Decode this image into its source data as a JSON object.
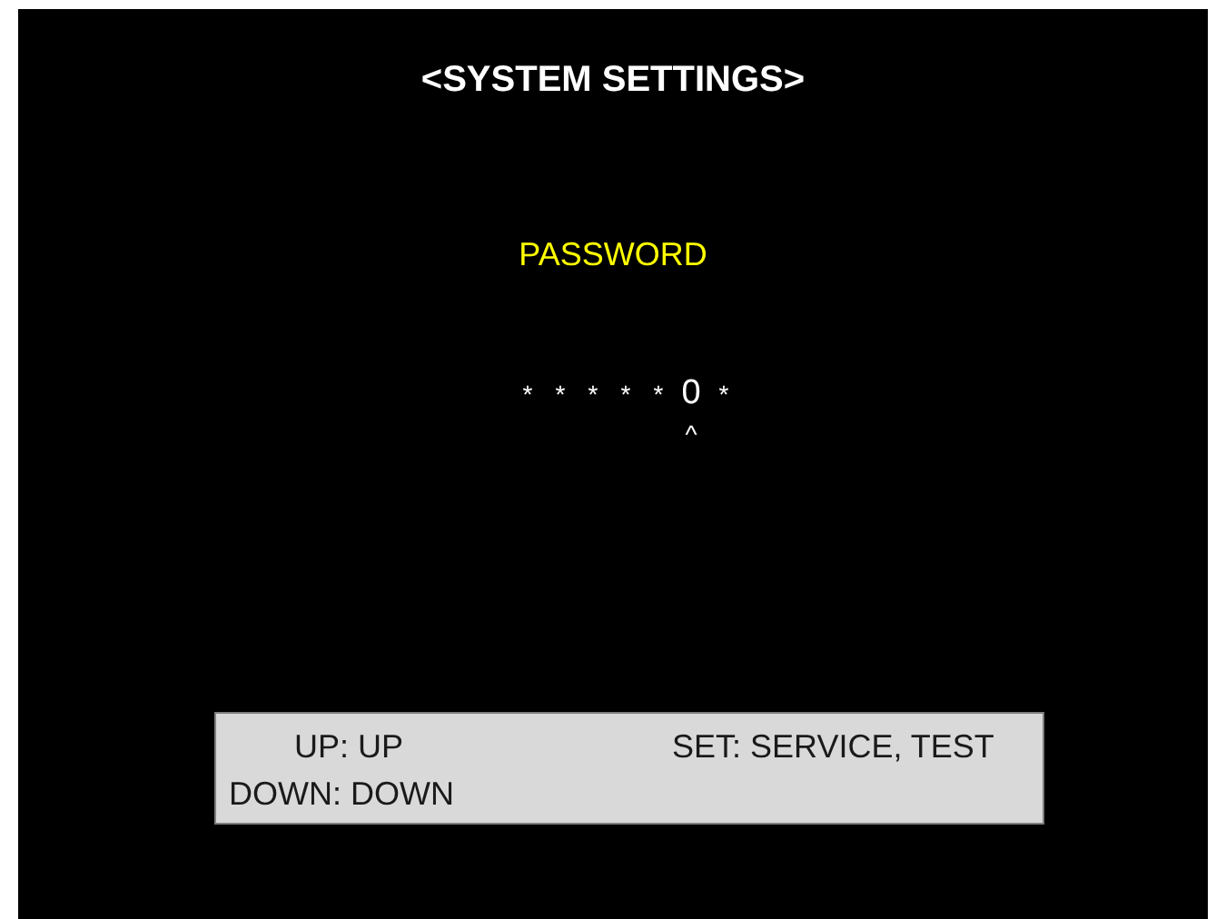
{
  "title": "<SYSTEM SETTINGS>",
  "prompt": "PASSWORD",
  "password": {
    "digits": [
      {
        "text": "*",
        "selected": false
      },
      {
        "text": "*",
        "selected": false
      },
      {
        "text": "*",
        "selected": false
      },
      {
        "text": "*",
        "selected": false
      },
      {
        "text": "*",
        "selected": false
      },
      {
        "text": "0",
        "selected": true
      },
      {
        "text": "*",
        "selected": false
      }
    ],
    "cursor": "^"
  },
  "help": {
    "rows": [
      [
        "UP: UP",
        "SET: SERVICE, TEST"
      ],
      [
        "DOWN: DOWN"
      ]
    ]
  }
}
